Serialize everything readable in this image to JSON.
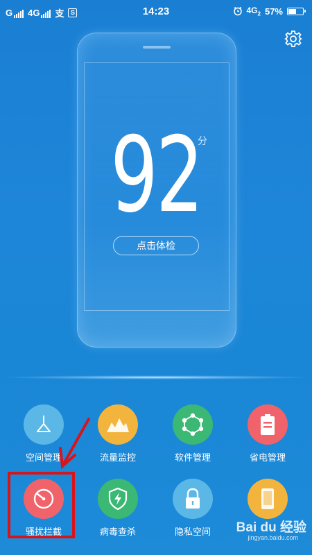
{
  "status_bar": {
    "sim1_label": "G",
    "sim2_label": "4G",
    "alipay_icon": "支",
    "s_icon": "S",
    "time": "14:23",
    "network_label": "4G",
    "network_sub": "2",
    "battery_percent": "57%",
    "battery_level": 0.57
  },
  "header": {
    "settings_icon": "gear-icon"
  },
  "score_card": {
    "score": "92",
    "unit": "分",
    "check_button_label": "点击体检"
  },
  "features": [
    {
      "label": "空间管理",
      "color": "#5bb8e6",
      "icon": "broom-icon"
    },
    {
      "label": "流量监控",
      "color": "#f2b43c",
      "icon": "traffic-chart-icon"
    },
    {
      "label": "软件管理",
      "color": "#3bb874",
      "icon": "app-hex-icon"
    },
    {
      "label": "省电管理",
      "color": "#f0636a",
      "icon": "battery-doc-icon"
    },
    {
      "label": "骚扰拦截",
      "color": "#f0636a",
      "icon": "block-target-icon"
    },
    {
      "label": "病毒查杀",
      "color": "#3bb874",
      "icon": "shield-bolt-icon"
    },
    {
      "label": "隐私空间",
      "color": "#5bb8e6",
      "icon": "lock-icon"
    },
    {
      "label": "",
      "color": "#f2b43c",
      "icon": "phone-icon"
    }
  ],
  "annotation": {
    "highlight_color": "#d8141b"
  },
  "watermark": {
    "brand": "Bai du 经验",
    "url": "jingyan.baidu.com"
  }
}
